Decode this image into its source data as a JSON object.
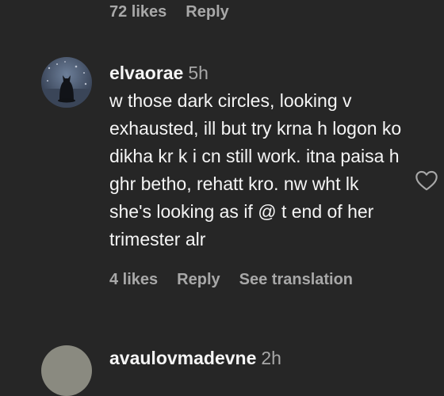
{
  "previous_comment": {
    "likes": "72 likes",
    "reply": "Reply"
  },
  "comment": {
    "username": "elvaorae",
    "time": "5h",
    "text": "w those dark circles, looking v exhausted, ill but try krna h logon ko dikha kr k i cn still work. itna paisa h ghr betho, rehatt kro. nw wht lk she's looking as if @ t end of her trimester alr",
    "likes": "4 likes",
    "reply": "Reply",
    "see_translation": "See translation"
  },
  "next_comment": {
    "username": "avaulovmadevne",
    "time": "2h"
  },
  "icons": {
    "like": "heart-outline-icon"
  },
  "colors": {
    "background": "#262626",
    "primary_text": "#f5f5f5",
    "secondary_text": "#a8a8a8"
  }
}
